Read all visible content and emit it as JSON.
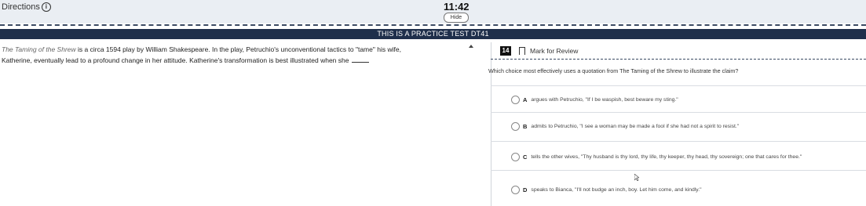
{
  "header": {
    "directions_label": "Directions",
    "timer": "11:42",
    "hide_label": "Hide"
  },
  "banner": {
    "text": "THIS IS A PRACTICE TEST DT41"
  },
  "passage": {
    "title_italic": "The Taming of the Shrew",
    "line1_rest": " is a circa 1594 play by William Shakespeare. In the play, Petruchio's unconventional tactics to \"tame\" his wife,",
    "line2": "Katherine, eventually lead to a profound change in her attitude. Katherine's transformation is best illustrated when she"
  },
  "question": {
    "number": "14",
    "mark_label": "Mark for Review",
    "prompt": "Which choice most effectively uses a quotation from The Taming of the Shrew to illustrate the claim?"
  },
  "choices": [
    {
      "letter": "A",
      "text": "argues with Petruchio, \"If I be waspish, best beware my sting.\""
    },
    {
      "letter": "B",
      "text": "admits to Petruchio, \"I see a woman may be made a fool if she had not a spirit to resist.\""
    },
    {
      "letter": "C",
      "text": "tells the other wives, \"Thy husband is thy lord, thy life, thy keeper, thy head, thy sovereign; one that cares for thee.\""
    },
    {
      "letter": "D",
      "text": "speaks to Bianca, \"I'll not budge an inch, boy. Let him come, and kindly.\""
    }
  ]
}
